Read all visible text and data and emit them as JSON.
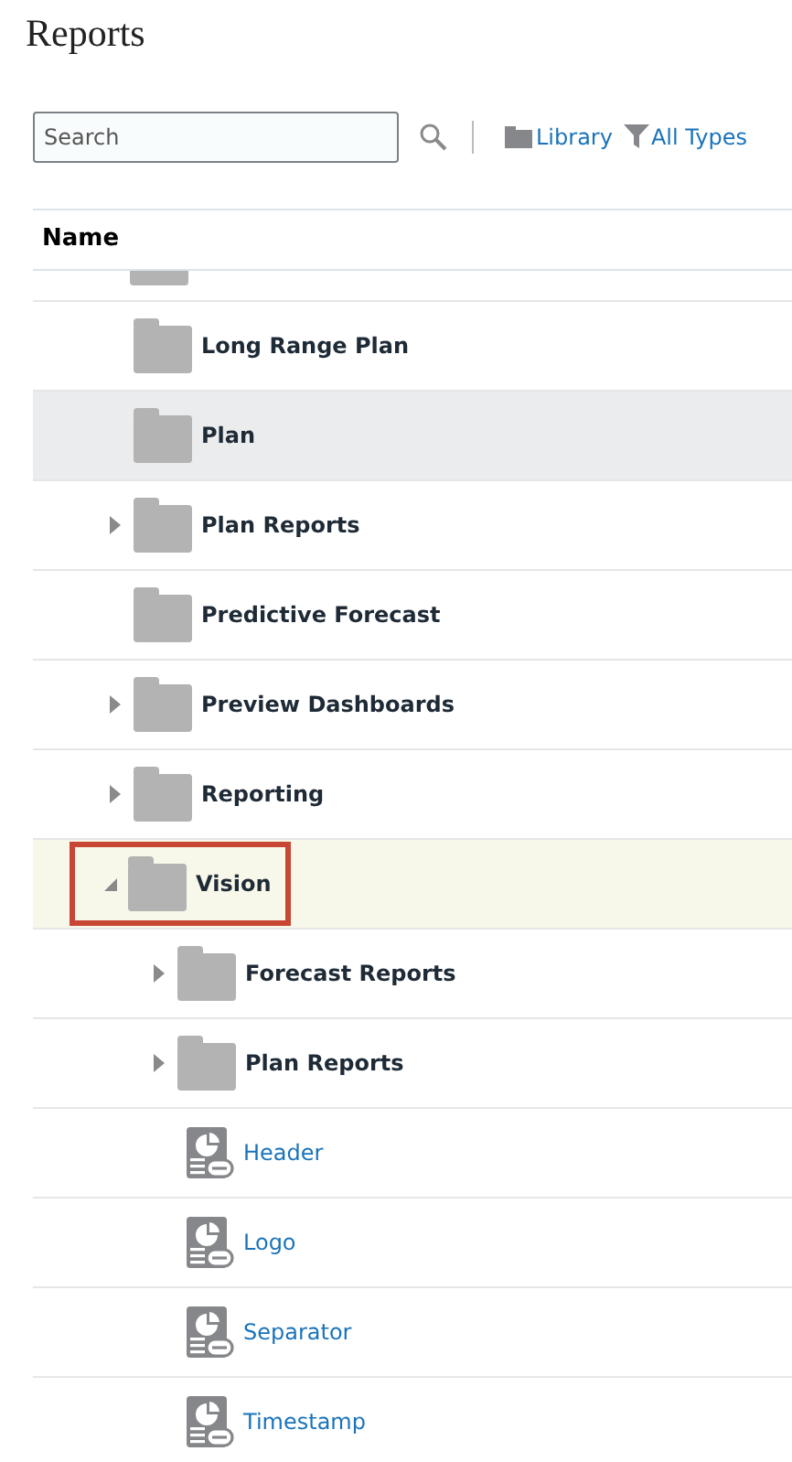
{
  "title": "Reports",
  "search": {
    "placeholder": "Search"
  },
  "toolbar": {
    "library": "Library",
    "filter": "All Types"
  },
  "table": {
    "columns": [
      "Name"
    ],
    "clipped_top_row": {
      "kind": "folder"
    },
    "rows": [
      {
        "name": "Long Range Plan",
        "kind": "folder",
        "selected": false,
        "hovered": false
      },
      {
        "name": "Plan",
        "kind": "folder",
        "selected": false,
        "hovered": true
      },
      {
        "name": "Plan Reports",
        "kind": "folder",
        "expanded": false,
        "selected": false,
        "hovered": false
      },
      {
        "name": "Predictive Forecast",
        "kind": "folder",
        "selected": false,
        "hovered": false
      },
      {
        "name": "Preview Dashboards",
        "kind": "folder",
        "expanded": false,
        "selected": false,
        "hovered": false
      },
      {
        "name": "Reporting",
        "kind": "folder",
        "expanded": false,
        "selected": false,
        "hovered": false
      },
      {
        "name": "Vision",
        "kind": "folder",
        "expanded": true,
        "selected": true,
        "hovered": false,
        "children": [
          {
            "name": "Forecast Reports",
            "kind": "folder",
            "expanded": false,
            "selected": false,
            "hovered": false
          },
          {
            "name": "Plan Reports",
            "kind": "folder",
            "expanded": false,
            "selected": false,
            "hovered": false
          },
          {
            "name": "Header",
            "kind": "report",
            "selected": false,
            "hovered": false
          },
          {
            "name": "Logo",
            "kind": "report",
            "selected": false,
            "hovered": false
          },
          {
            "name": "Separator",
            "kind": "report",
            "selected": false,
            "hovered": false
          },
          {
            "name": "Timestamp",
            "kind": "report",
            "selected": false,
            "hovered": false
          }
        ]
      }
    ]
  }
}
